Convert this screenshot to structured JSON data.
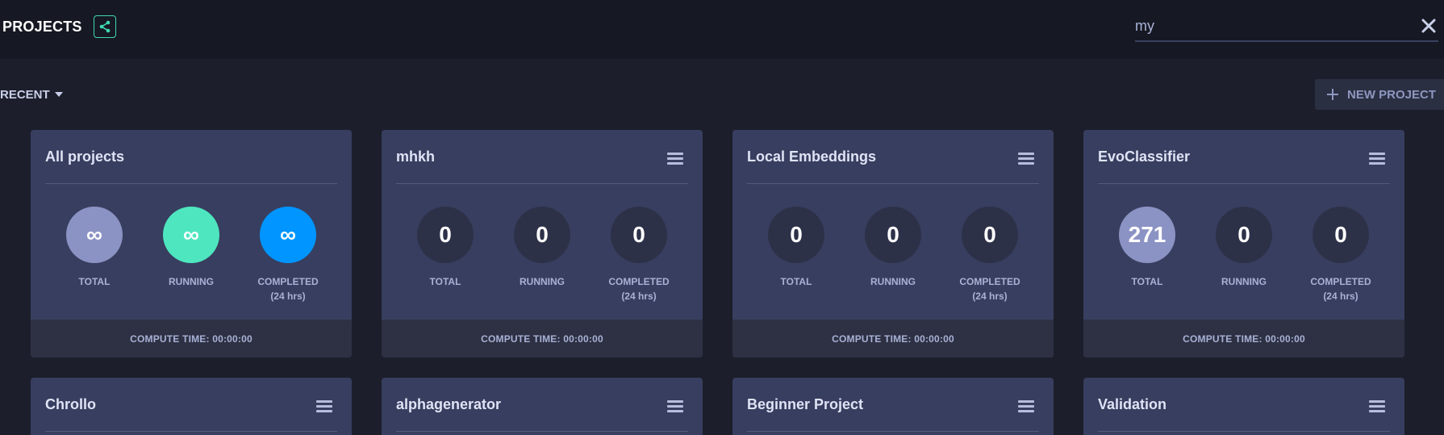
{
  "header": {
    "title": "PROJECTS",
    "share_icon": "share-icon",
    "search": {
      "value": "my",
      "placeholder": ""
    },
    "clear_icon": "close-icon"
  },
  "toolbar": {
    "sort_label": "RECENT",
    "new_project_label": "NEW PROJECT"
  },
  "labels": {
    "total": "TOTAL",
    "running": "RUNNING",
    "completed": "COMPLETED",
    "completed_sub": "(24 hrs)"
  },
  "colors": {
    "accent": "#3fd8b0",
    "total_all": "#8b93c4",
    "running_all": "#4ee6bf",
    "completed_all": "#0095ff",
    "circle_default": "#2d3148",
    "card_bg": "#383e5f"
  },
  "cards": [
    {
      "title": "All projects",
      "total": "∞",
      "running": "∞",
      "completed": "∞",
      "footer": "COMPUTE TIME: 00:00:00",
      "has_menu": false
    },
    {
      "title": "mhkh",
      "total": "0",
      "running": "0",
      "completed": "0",
      "footer": "COMPUTE TIME: 00:00:00",
      "has_menu": true
    },
    {
      "title": "Local Embeddings",
      "total": "0",
      "running": "0",
      "completed": "0",
      "footer": "COMPUTE TIME: 00:00:00",
      "has_menu": true
    },
    {
      "title": "EvoClassifier",
      "total": "271",
      "running": "0",
      "completed": "0",
      "footer": "COMPUTE TIME: 00:00:00",
      "has_menu": true
    },
    {
      "title": "Chrollo"
    },
    {
      "title": "alphagenerator"
    },
    {
      "title": "Beginner Project"
    },
    {
      "title": "Validation"
    }
  ]
}
